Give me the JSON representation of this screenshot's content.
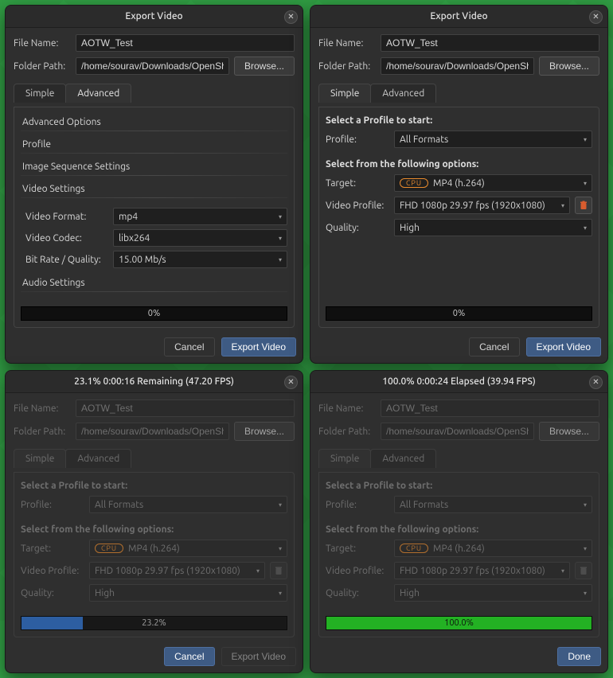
{
  "titles": {
    "w1": "Export Video",
    "w2": "Export Video",
    "w3": "23.1%  0:00:16 Remaining (47.20 FPS)",
    "w4": "100.0%  0:00:24 Elapsed (39.94 FPS)"
  },
  "labels": {
    "file_name": "File Name:",
    "folder_path": "Folder Path:",
    "browse": "Browse...",
    "simple_tab": "Simple",
    "advanced_tab": "Advanced",
    "advanced_options": "Advanced Options",
    "profile_hdr": "Profile",
    "image_seq": "Image Sequence Settings",
    "video_settings": "Video Settings",
    "video_format": "Video Format:",
    "video_codec": "Video Codec:",
    "bitrate": "Bit Rate / Quality:",
    "audio_settings": "Audio Settings",
    "select_profile_start": "Select a Profile to start:",
    "profile": "Profile:",
    "select_following": "Select from the following options:",
    "target": "Target:",
    "video_profile": "Video Profile:",
    "quality": "Quality:",
    "cancel": "Cancel",
    "export": "Export Video",
    "done": "Done",
    "cpu_badge": "CPU"
  },
  "values": {
    "file_name": "AOTW_Test",
    "folder_path": "/home/sourav/Downloads/OpenShot",
    "video_format": "mp4",
    "video_codec": "libx264",
    "bitrate": "15.00 Mb/s",
    "profile_option": "All Formats",
    "target_option": "MP4 (h.264)",
    "video_profile_option": "FHD 1080p 29.97 fps (1920x1080)",
    "quality_option": "High"
  },
  "progress": {
    "w1_text": "0%",
    "w1_pct": 0,
    "w2_text": "0%",
    "w2_pct": 0,
    "w3_text": "23.2%",
    "w3_pct": 23.2,
    "w4_text": "100.0%",
    "w4_pct": 100
  }
}
